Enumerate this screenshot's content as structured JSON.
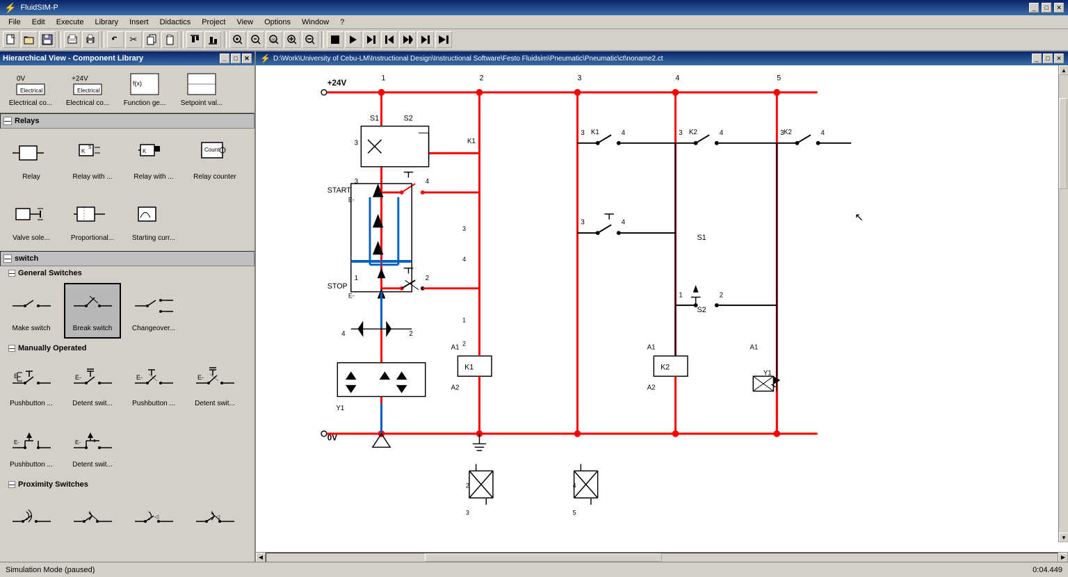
{
  "app": {
    "title": "FluidSIM-P",
    "status": "Simulation Mode (paused)",
    "timestamp": "0:04.449"
  },
  "menu": {
    "items": [
      "File",
      "Edit",
      "Execute",
      "Library",
      "Insert",
      "Didactics",
      "Project",
      "View",
      "Options",
      "Window",
      "?"
    ]
  },
  "library": {
    "title": "Hierarchical View - Component Library",
    "categories": [
      {
        "name": "Electrical components top",
        "label": "0V"
      },
      {
        "name": "Electrical components",
        "label": "+24V"
      }
    ],
    "relays": {
      "header": "Relays",
      "items": [
        {
          "label": "Relay",
          "icon": "relay"
        },
        {
          "label": "Relay with ...",
          "icon": "relay-with-1"
        },
        {
          "label": "Relay with ...",
          "icon": "relay-with-2"
        },
        {
          "label": "Relay counter",
          "icon": "relay-counter"
        }
      ]
    },
    "switch": {
      "header": "switch",
      "general_switches": {
        "header": "General Switches",
        "items": [
          {
            "label": "Make switch",
            "icon": "make-switch",
            "selected": false
          },
          {
            "label": "Break switch",
            "icon": "break-switch",
            "selected": true
          },
          {
            "label": "Changeover...",
            "icon": "changeover"
          }
        ]
      },
      "manually_operated": {
        "header": "Manually Operated",
        "items": [
          {
            "label": "Pushbutton ...",
            "icon": "pushbutton-1"
          },
          {
            "label": "Detent swit...",
            "icon": "detent-switch-1"
          },
          {
            "label": "Pushbutton ...",
            "icon": "pushbutton-2"
          },
          {
            "label": "Detent swit...",
            "icon": "detent-switch-2"
          },
          {
            "label": "Pushbutton ...",
            "icon": "pushbutton-3"
          },
          {
            "label": "Detent swit...",
            "icon": "detent-switch-3"
          }
        ]
      },
      "proximity_switches": {
        "header": "Proximity Switches",
        "items": [
          {
            "label": "",
            "icon": "prox-1"
          },
          {
            "label": "",
            "icon": "prox-2"
          },
          {
            "label": "",
            "icon": "prox-3"
          },
          {
            "label": "",
            "icon": "prox-4"
          }
        ]
      }
    }
  },
  "schematic": {
    "title": "D:\\Work\\University of Cebu-LM\\Instructional Design\\Instructional Software\\Festo Fluidsim\\Pneumatic\\Pneumatic\\ct\\noname2.ct",
    "labels": {
      "top_voltage": "+24V",
      "bottom_voltage": "0V",
      "start": "START",
      "stop": "STOP",
      "columns": [
        "1",
        "2",
        "3",
        "4",
        "5"
      ],
      "s1": "S1",
      "s2": "S2",
      "k1": "K1",
      "k2": "K2",
      "y1": "Y1",
      "a1": "A1",
      "a2": "A2"
    }
  },
  "toolbar": {
    "buttons": [
      {
        "name": "new",
        "icon": "📄"
      },
      {
        "name": "open",
        "icon": "📂"
      },
      {
        "name": "save",
        "icon": "💾"
      },
      {
        "name": "print-preview",
        "icon": "🖨"
      },
      {
        "name": "print",
        "icon": "🖨"
      },
      {
        "name": "undo",
        "icon": "↩"
      },
      {
        "name": "cut",
        "icon": "✂"
      },
      {
        "name": "copy",
        "icon": "📋"
      },
      {
        "name": "paste",
        "icon": "📌"
      },
      {
        "name": "zoom-in",
        "icon": "🔍"
      },
      {
        "name": "zoom-out",
        "icon": "🔍"
      },
      {
        "name": "stop",
        "icon": "⏹"
      },
      {
        "name": "play",
        "icon": "▶"
      },
      {
        "name": "step",
        "icon": "⏭"
      }
    ]
  }
}
